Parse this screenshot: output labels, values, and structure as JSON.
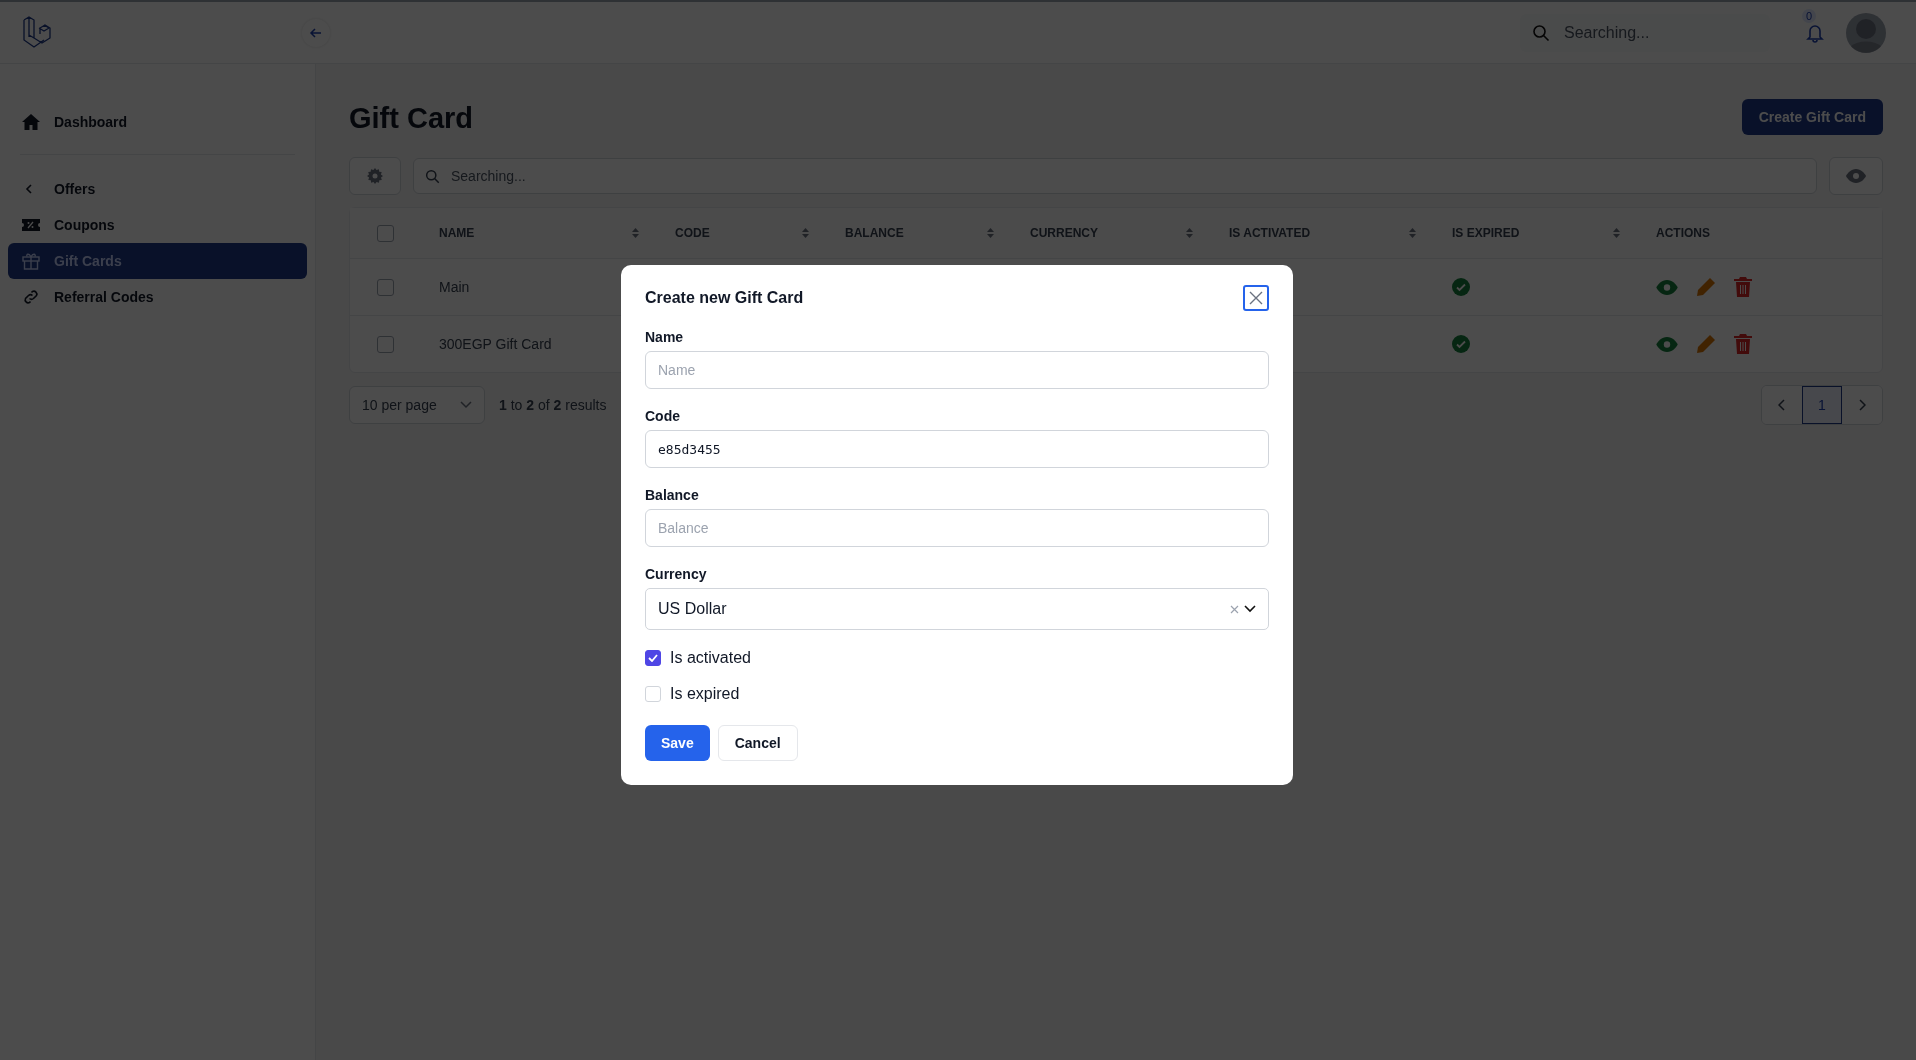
{
  "topbar": {
    "search": {
      "placeholder": "Searching..."
    },
    "notifications": {
      "count": "0"
    }
  },
  "sidebar": {
    "items": [
      {
        "label": "Dashboard",
        "kind": "home",
        "selected": false
      },
      {
        "label": "Offers",
        "kind": "chevron",
        "selected": false
      },
      {
        "label": "Coupons",
        "kind": "ticket",
        "selected": false
      },
      {
        "label": "Gift Cards",
        "kind": "gift",
        "selected": true
      },
      {
        "label": "Referral Codes",
        "kind": "link",
        "selected": false
      }
    ]
  },
  "page": {
    "title": "Gift Card",
    "create_button": "Create Gift Card"
  },
  "toolbar": {
    "search": {
      "placeholder": "Searching..."
    }
  },
  "table": {
    "select_all": {
      "checked": false
    },
    "columns": [
      {
        "label": "NAME",
        "sortable": true
      },
      {
        "label": "CODE",
        "sortable": true
      },
      {
        "label": "BALANCE",
        "sortable": true
      },
      {
        "label": "CURRENCY",
        "sortable": true
      },
      {
        "label": "IS ACTIVATED",
        "sortable": true
      },
      {
        "label": "IS EXPIRED",
        "sortable": true
      },
      {
        "label": "ACTIONS",
        "sortable": false
      }
    ],
    "rows": [
      {
        "name": "Main",
        "checked": false,
        "is_expired": true
      },
      {
        "name": "300EGP Gift Card",
        "checked": false,
        "is_expired": true
      }
    ]
  },
  "pagination": {
    "per_page": "10 per page",
    "summary": "**1** to **2** of **2** results",
    "pages": [
      {
        "label": "1",
        "selected": true
      }
    ]
  },
  "modal": {
    "title": "Create new Gift Card",
    "fields": [
      {
        "kind": "text",
        "label": "Name",
        "placeholder": "Name"
      },
      {
        "kind": "text",
        "label": "Code",
        "value": "e85d3455"
      },
      {
        "kind": "text",
        "label": "Balance",
        "placeholder": "Balance"
      },
      {
        "kind": "select",
        "label": "Currency",
        "value": "US Dollar"
      }
    ],
    "checkboxes": [
      {
        "label": "Is activated",
        "checked": true
      },
      {
        "label": "Is expired",
        "checked": false
      }
    ],
    "buttons": [
      {
        "label": "Save",
        "kind": "primary"
      },
      {
        "label": "Cancel",
        "kind": "secondary"
      }
    ]
  }
}
